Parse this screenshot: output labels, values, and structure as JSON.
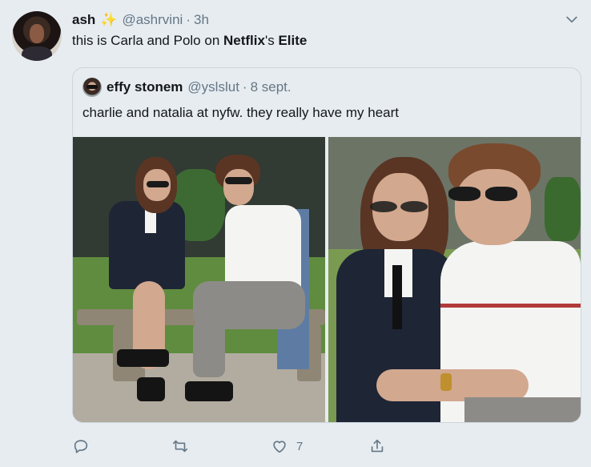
{
  "tweet": {
    "author_name": "ash",
    "author_emoji": "✨",
    "handle": "@ashrvini",
    "separator": "·",
    "time": "3h",
    "text": {
      "part1": "this is Carla and Polo on ",
      "bold1": "Netflix",
      "part2": "'s ",
      "bold2": "Elite"
    }
  },
  "quoted": {
    "author_name": "effy stonem",
    "handle": "@yslslut",
    "separator": "·",
    "date": "8 sept.",
    "text": "charlie and natalia at nyfw. they really have my heart"
  },
  "actions": {
    "reply_count": "",
    "retweet_count": "",
    "like_count": "7",
    "share_count": ""
  },
  "icons": {
    "caret": "chevron-down-icon",
    "reply": "reply-icon",
    "retweet": "retweet-icon",
    "like": "heart-icon",
    "share": "share-icon"
  },
  "colors": {
    "background": "#e6ecf0",
    "secondary_text": "#657786",
    "primary_text": "#14171a",
    "border": "#ccd6dd"
  }
}
